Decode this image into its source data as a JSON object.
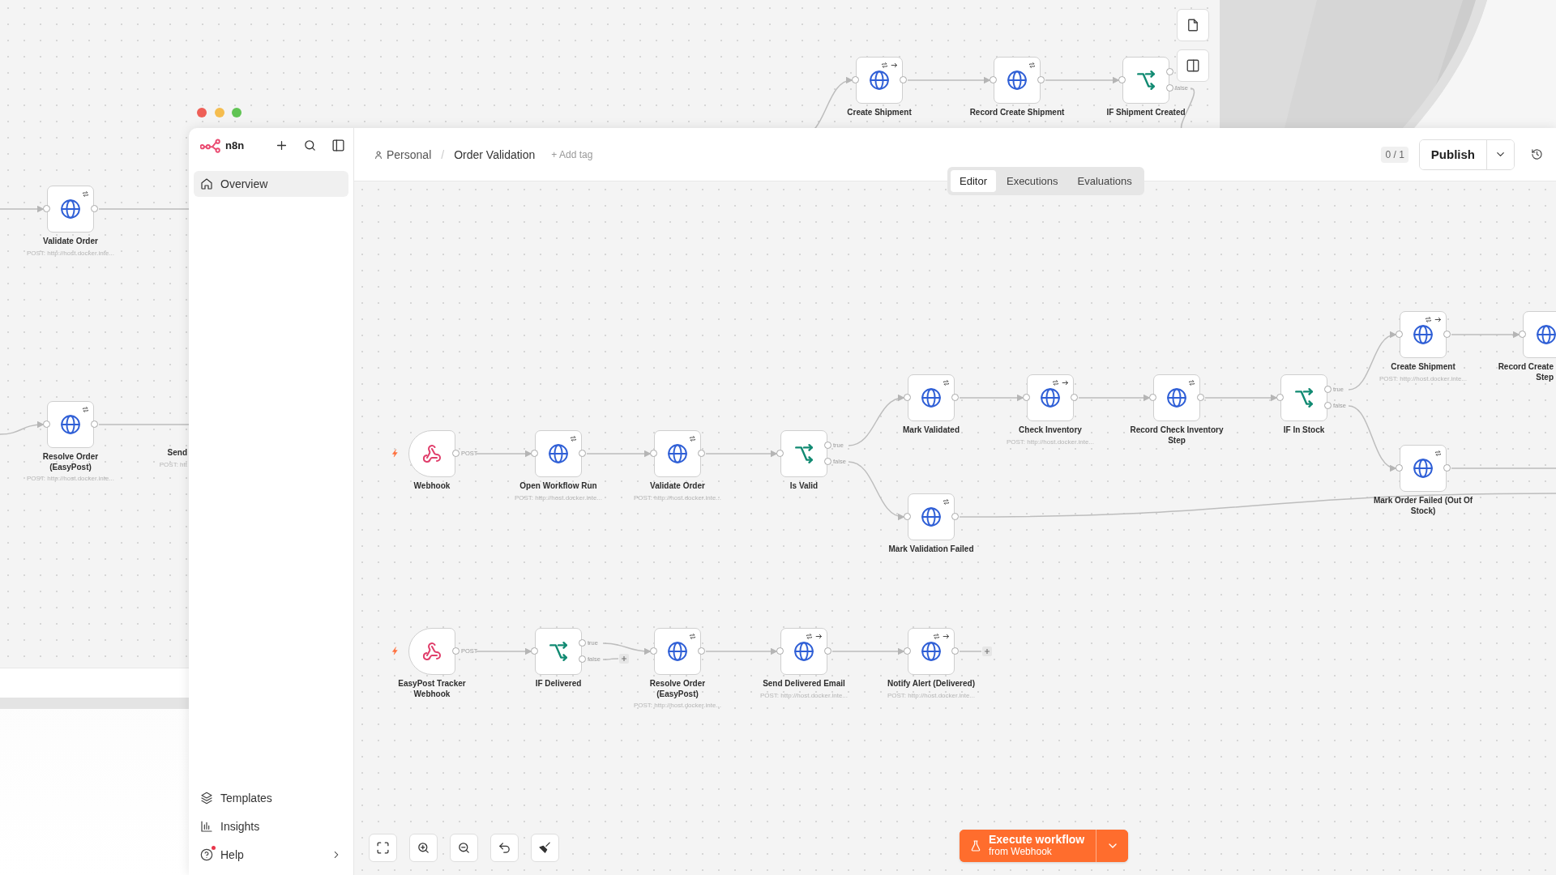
{
  "background_window": {
    "canvas": {
      "nodes": [
        {
          "kind": "http",
          "label": "Validate Order",
          "subtitle": "POST: http://host.docker.inte...",
          "retry_badge": true,
          "arrow_badge": false
        },
        {
          "kind": "http",
          "label": "Resolve Order (EasyPost)",
          "subtitle": "POST: http://host.docker.inte...",
          "retry_badge": true,
          "arrow_badge": false
        },
        {
          "kind": "http",
          "label": "Create Shipment",
          "retry_badge": true,
          "arrow_badge": true
        },
        {
          "kind": "http",
          "label": "Record Create Shipment",
          "retry_badge": true,
          "arrow_badge": false
        },
        {
          "kind": "if",
          "label": "IF Shipment Created",
          "false_label": "false",
          "retry_badge": false,
          "arrow_badge": false
        }
      ],
      "covered_labels": [
        {
          "label": "Send",
          "subtitle": "POST: htt"
        }
      ]
    }
  },
  "window": {
    "sidebar": {
      "brand": "n8n",
      "items": [
        {
          "label": "Overview",
          "selected": true
        }
      ],
      "footer_items": [
        {
          "label": "Templates",
          "notification": false,
          "has_submenu": false
        },
        {
          "label": "Insights",
          "notification": false,
          "has_submenu": false
        },
        {
          "label": "Help",
          "notification": true,
          "has_submenu": true
        }
      ]
    },
    "header": {
      "breadcrumb": {
        "project": "Personal",
        "separator": "/",
        "workflow": "Order Validation"
      },
      "add_tag": "+ Add tag",
      "version_count": "0 / 1",
      "publish_button": "Publish"
    },
    "tabs": [
      {
        "label": "Editor",
        "selected": true
      },
      {
        "label": "Executions",
        "selected": false
      },
      {
        "label": "Evaluations",
        "selected": false
      }
    ],
    "canvas": {
      "nodes": [
        {
          "kind": "webhook",
          "label": "Webhook",
          "method_label": "POST",
          "retry_badge": false,
          "arrow_badge": false
        },
        {
          "kind": "http",
          "label": "Open Workflow Run",
          "subtitle": "POST: http://host.docker.inte...",
          "retry_badge": true,
          "arrow_badge": false
        },
        {
          "kind": "http",
          "label": "Validate Order",
          "subtitle": "POST: http://host.docker.inte...",
          "retry_badge": true,
          "arrow_badge": false
        },
        {
          "kind": "if",
          "label": "Is Valid",
          "true_label": "true",
          "false_label": "false",
          "retry_badge": false,
          "arrow_badge": false
        },
        {
          "kind": "http",
          "label": "Mark Validated",
          "retry_badge": true,
          "arrow_badge": false
        },
        {
          "kind": "http",
          "label": "Check Inventory",
          "subtitle": "POST: http://host.docker.inte...",
          "retry_badge": true,
          "arrow_badge": true
        },
        {
          "kind": "http",
          "label": "Record Check Inventory Step",
          "retry_badge": true,
          "arrow_badge": false
        },
        {
          "kind": "if",
          "label": "IF In Stock",
          "true_label": "true",
          "false_label": "false",
          "retry_badge": false,
          "arrow_badge": false
        },
        {
          "kind": "http",
          "label": "Create Shipment",
          "subtitle": "POST: http://host.docker.inte...",
          "retry_badge": true,
          "arrow_badge": true
        },
        {
          "kind": "http",
          "label": "Record Create\nStep",
          "retry_badge": false,
          "arrow_badge": false
        },
        {
          "kind": "http",
          "label": "Mark Validation Failed",
          "retry_badge": true,
          "arrow_badge": false
        },
        {
          "kind": "http",
          "label": "Mark Order Failed (Out Of Stock)",
          "retry_badge": true,
          "arrow_badge": false
        },
        {
          "kind": "webhook",
          "label": "EasyPost Tracker Webhook",
          "method_label": "POST",
          "retry_badge": false,
          "arrow_badge": false
        },
        {
          "kind": "if",
          "label": "IF Delivered",
          "true_label": "true",
          "false_label": "false",
          "retry_badge": false,
          "arrow_badge": false
        },
        {
          "kind": "http",
          "label": "Resolve Order (EasyPost)",
          "subtitle": "POST: http://host.docker.inte...",
          "retry_badge": true,
          "arrow_badge": false
        },
        {
          "kind": "http",
          "label": "Send Delivered Email",
          "subtitle": "POST: http://host.docker.inte...",
          "retry_badge": true,
          "arrow_badge": true
        },
        {
          "kind": "http",
          "label": "Notify Alert (Delivered)",
          "subtitle": "POST: http://host.docker.inte...",
          "retry_badge": true,
          "arrow_badge": true
        }
      ]
    },
    "execute_button": {
      "label": "Execute workflow",
      "sublabel": "from Webhook"
    }
  }
}
